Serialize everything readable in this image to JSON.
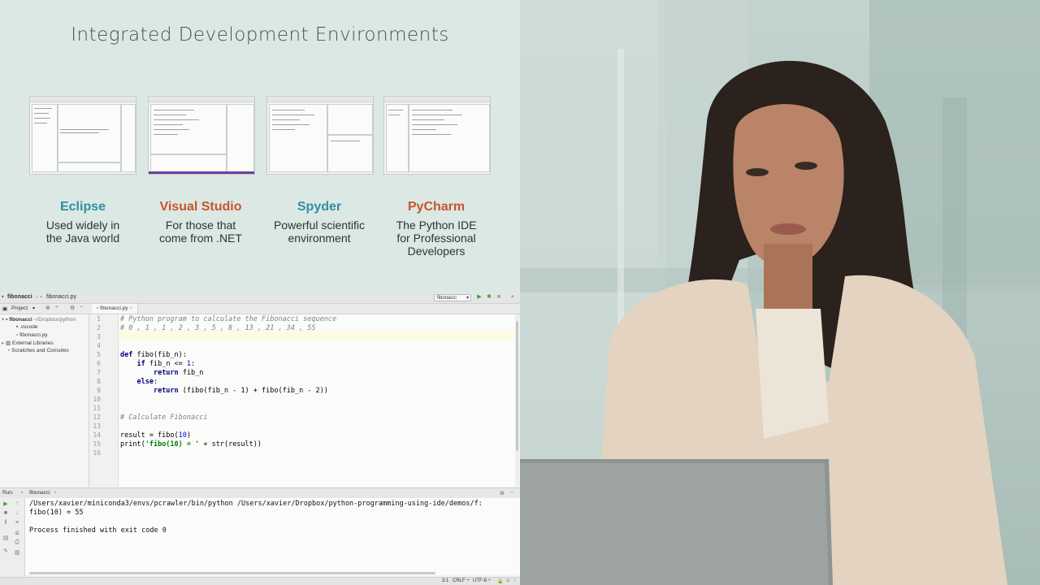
{
  "slide": {
    "title": "Integrated Development Environments",
    "ides": [
      {
        "name": "Eclipse",
        "desc_line1": "Used widely in",
        "desc_line2": "the Java world",
        "desc_line3": "",
        "color": "#2f8fa0"
      },
      {
        "name": "Visual Studio",
        "desc_line1": "For those that",
        "desc_line2": "come from .NET",
        "desc_line3": "",
        "color": "#c9552a"
      },
      {
        "name": "Spyder",
        "desc_line1": "Powerful scientific",
        "desc_line2": "environment",
        "desc_line3": "",
        "color": "#2f8fa0"
      },
      {
        "name": "PyCharm",
        "desc_line1": "The Python IDE",
        "desc_line2": "for Professional",
        "desc_line3": "Developers",
        "color": "#c9552a"
      }
    ]
  },
  "ide": {
    "breadcrumb": {
      "project": "fibonacci",
      "file": "fibonacci.py"
    },
    "run_config": "fibonacci",
    "project_label": "Project",
    "tab_label": "fibonacci.py",
    "tree": {
      "root": "fibonacci",
      "root_path": "~/Dropbox/python",
      "vscode": ".vscode",
      "file": "fibonacci.py",
      "ext_libs": "External Libraries",
      "scratches": "Scratches and Consoles"
    },
    "line_numbers": [
      "1",
      "2",
      "3",
      "4",
      "5",
      "6",
      "7",
      "8",
      "9",
      "10",
      "11",
      "12",
      "13",
      "14",
      "15",
      "16"
    ],
    "code": {
      "l1": "# Python program to calculate the Fibonacci sequence",
      "l2": "# 0 , 1 , 1 , 2 , 3 , 5 , 8 , 13 , 21 , 34 , 55",
      "l5_kw": "def",
      "l5_rest": " fibo(fib_n):",
      "l6_kw": "if",
      "l6_rest": " fib_n <= ",
      "l6_num": "1",
      "l6_end": ":",
      "l7_kw": "return",
      "l7_rest": " fib_n",
      "l8_kw": "else",
      "l8_rest": ":",
      "l9_kw": "return",
      "l9_rest": " (fibo(fib_n - 1) + fibo(fib_n - 2))",
      "l12": "# Calculate Fibonacci",
      "l14_a": "result = fibo(",
      "l14_num": "10",
      "l14_b": ")",
      "l15_a": "print(",
      "l15_str": "'fibo(10) = '",
      "l15_b": " + str(result))"
    },
    "run": {
      "label": "Run:",
      "tab": "fibonacci",
      "cmd": "/Users/xavier/miniconda3/envs/pcrawler/bin/python /Users/xavier/Dropbox/python-programming-using-ide/demos/f:",
      "output": "fibo(10) = 55",
      "exit": "Process finished with exit code 0"
    },
    "status": {
      "position": "3:1",
      "line_sep": "CRLF ÷",
      "encoding": "UTF-8 ÷"
    }
  }
}
